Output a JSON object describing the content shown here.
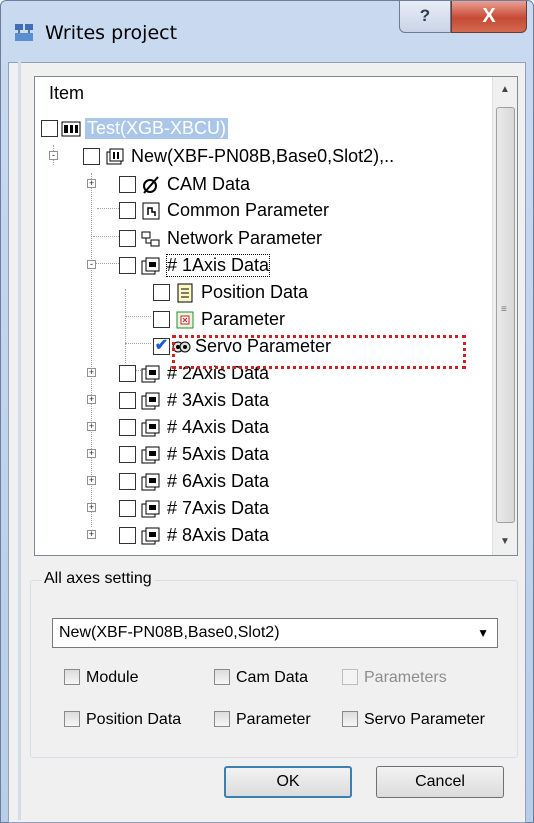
{
  "window": {
    "title": "Writes project",
    "help_label": "?",
    "close_label": "X"
  },
  "tree": {
    "header": "Item",
    "rows": [
      {
        "label": "Test(XGB-XBCU)",
        "icon": "plc-icon"
      },
      {
        "label": "New(XBF-PN08B,Base0,Slot2),..",
        "icon": "module-icon",
        "expander": "-"
      },
      {
        "label": "CAM Data",
        "icon": "cam-icon",
        "expander": "+"
      },
      {
        "label": "Common Parameter",
        "icon": "common-param-icon"
      },
      {
        "label": "Network Parameter",
        "icon": "network-icon"
      },
      {
        "label": "# 1Axis Data",
        "icon": "axis-icon",
        "expander": "-"
      },
      {
        "label": "Position Data",
        "icon": "position-icon"
      },
      {
        "label": "Parameter",
        "icon": "parameter-icon"
      },
      {
        "label": "Servo Parameter",
        "icon": "servo-icon",
        "checked": true
      },
      {
        "label": "# 2Axis Data",
        "icon": "axis-icon",
        "expander": "+"
      },
      {
        "label": "# 3Axis Data",
        "icon": "axis-icon",
        "expander": "+"
      },
      {
        "label": "# 4Axis Data",
        "icon": "axis-icon",
        "expander": "+"
      },
      {
        "label": "# 5Axis Data",
        "icon": "axis-icon",
        "expander": "+"
      },
      {
        "label": "# 6Axis Data",
        "icon": "axis-icon",
        "expander": "+"
      },
      {
        "label": "# 7Axis Data",
        "icon": "axis-icon",
        "expander": "+"
      },
      {
        "label": "# 8Axis Data",
        "icon": "axis-icon",
        "expander": "+"
      }
    ]
  },
  "settings": {
    "group_title": "All axes setting",
    "combo_value": "New(XBF-PN08B,Base0,Slot2)",
    "options": {
      "module": "Module",
      "cam_data": "Cam Data",
      "parameters": "Parameters",
      "position_data": "Position Data",
      "parameter": "Parameter",
      "servo_parameter": "Servo Parameter"
    }
  },
  "buttons": {
    "ok": "OK",
    "cancel": "Cancel"
  },
  "colors": {
    "highlight": "#d21f1f",
    "selection": "#aac7ea",
    "check": "#1c5ad8"
  }
}
